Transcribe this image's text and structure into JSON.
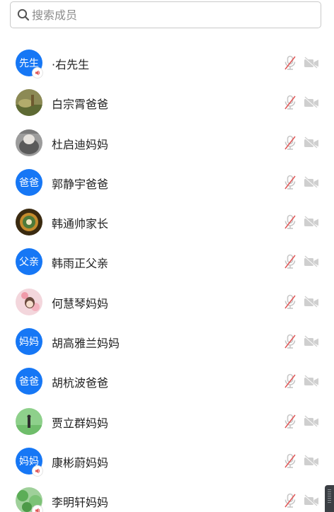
{
  "search": {
    "placeholder": "搜索成员",
    "value": ""
  },
  "colors": {
    "accent": "#1677f5",
    "mic_muted": "#e05a5a",
    "cam_off": "#cfcfcf"
  },
  "members": [
    {
      "name": "·右先生",
      "avatar_text": "先生",
      "avatar_type": "text",
      "speaker_badge": true
    },
    {
      "name": "白宗霄爸爸",
      "avatar_text": "",
      "avatar_type": "photo-olive",
      "speaker_badge": false
    },
    {
      "name": "杜启迪妈妈",
      "avatar_text": "",
      "avatar_type": "photo-gray",
      "speaker_badge": false
    },
    {
      "name": "郭静宇爸爸",
      "avatar_text": "爸爸",
      "avatar_type": "text",
      "speaker_badge": false
    },
    {
      "name": "韩通帅家长",
      "avatar_text": "",
      "avatar_type": "photo-dark",
      "speaker_badge": false
    },
    {
      "name": "韩雨正父亲",
      "avatar_text": "父亲",
      "avatar_type": "text",
      "speaker_badge": false
    },
    {
      "name": "何慧琴妈妈",
      "avatar_text": "",
      "avatar_type": "photo-pink",
      "speaker_badge": false
    },
    {
      "name": "胡高雅兰妈妈",
      "avatar_text": "妈妈",
      "avatar_type": "text",
      "speaker_badge": false
    },
    {
      "name": "胡杭波爸爸",
      "avatar_text": "爸爸",
      "avatar_type": "text",
      "speaker_badge": false
    },
    {
      "name": "贾立群妈妈",
      "avatar_text": "",
      "avatar_type": "photo-green",
      "speaker_badge": false
    },
    {
      "name": "康彬蔚妈妈",
      "avatar_text": "妈妈",
      "avatar_type": "text",
      "speaker_badge": true
    },
    {
      "name": "李明轩妈妈",
      "avatar_text": "",
      "avatar_type": "photo-leaf",
      "speaker_badge": true
    }
  ]
}
